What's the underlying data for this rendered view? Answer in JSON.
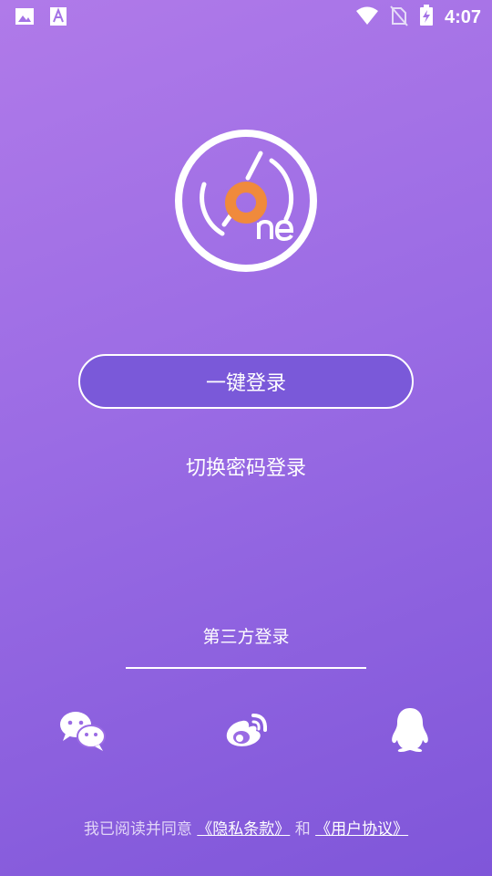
{
  "status_bar": {
    "time": "4:07",
    "left_icons": [
      "gallery-notification-icon",
      "text-a-notification-icon"
    ],
    "right_icons": [
      "wifi-icon",
      "no-sim-icon",
      "battery-charging-icon"
    ]
  },
  "logo": {
    "name": "one-logo",
    "accent_color": "#f08a3c"
  },
  "login": {
    "one_key_label": "一键登录",
    "switch_password_label": "切换密码登录"
  },
  "third_party": {
    "title": "第三方登录",
    "options": [
      "wechat-icon",
      "weibo-icon",
      "qq-icon"
    ]
  },
  "agreement": {
    "prefix": "我已阅读并同意",
    "privacy_link": "《隐私条款》",
    "and": "和",
    "user_link": "《用户协议》"
  },
  "colors": {
    "bg_top": "#b07ae9",
    "bg_bottom": "#7f56d9",
    "button_fill": "#7a59d9"
  }
}
